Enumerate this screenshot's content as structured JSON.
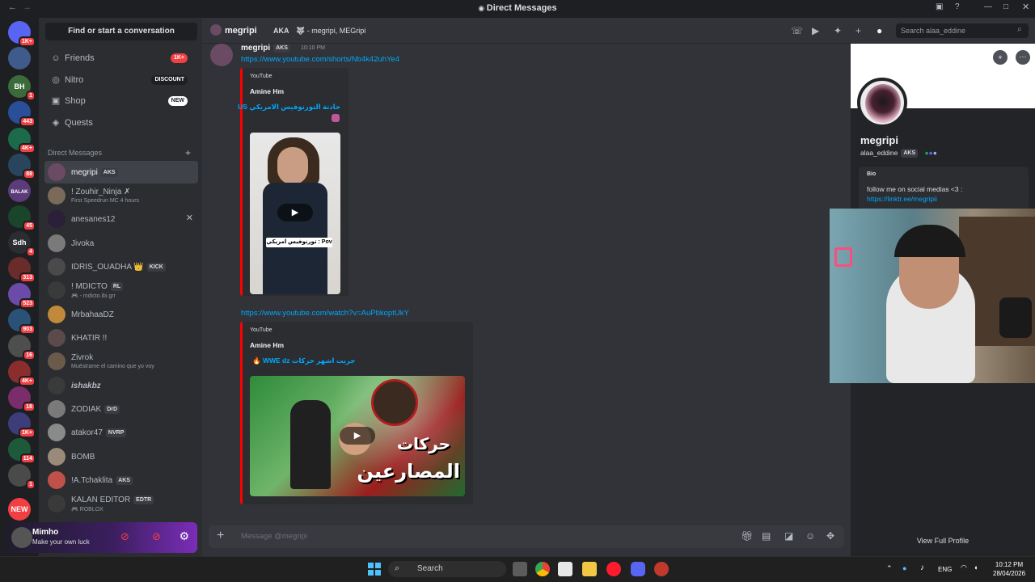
{
  "window": {
    "title": "Direct Messages"
  },
  "server_rail": {
    "items": [
      {
        "label": "",
        "badge": "1K+",
        "color": "#5865f2"
      },
      {
        "label": "",
        "badge": "",
        "color": "#3f5b8c"
      },
      {
        "label": "BH",
        "badge": "1",
        "color": "#3b6b3b"
      },
      {
        "label": "",
        "badge": "443",
        "color": "#2a4f9a"
      },
      {
        "label": "",
        "badge": "4K+",
        "color": "#1b6b4a"
      },
      {
        "label": "",
        "badge": "88",
        "color": "#29455e"
      },
      {
        "label": "BALAK",
        "badge": "",
        "color": "#5b3b7a"
      },
      {
        "label": "",
        "badge": "45",
        "color": "#19462a"
      },
      {
        "label": "Sdh",
        "badge": "4",
        "color": "#2b2d31"
      },
      {
        "label": "",
        "badge": "313",
        "color": "#6a2b2b"
      },
      {
        "label": "",
        "badge": "523",
        "color": "#6b4aa8"
      },
      {
        "label": "",
        "badge": "903",
        "color": "#2a5276"
      },
      {
        "label": "",
        "badge": "16",
        "color": "#4e4e4e"
      },
      {
        "label": "",
        "badge": "4K+",
        "color": "#8a2d2d"
      },
      {
        "label": "",
        "badge": "18",
        "color": "#7a2d6a"
      },
      {
        "label": "",
        "badge": "1K+",
        "color": "#3d3d7a"
      },
      {
        "label": "",
        "badge": "114",
        "color": "#1e5a3a"
      },
      {
        "label": "",
        "badge": "1",
        "color": "#4a4a4a"
      },
      {
        "label": "NEW",
        "badge": "",
        "color": "#f23f43"
      }
    ]
  },
  "sidebar": {
    "find_label": "Find or start a conversation",
    "nav": [
      {
        "label": "Friends",
        "icon": "friends-icon",
        "tag": "1K+",
        "tag_color": "#f23f43"
      },
      {
        "label": "Nitro",
        "icon": "nitro-icon",
        "tag": "DISCOUNT",
        "tag_color": "#1e1f22"
      },
      {
        "label": "Shop",
        "icon": "shop-icon",
        "tag": "NEW",
        "tag_color": "#ffffff"
      },
      {
        "label": "Quests",
        "icon": "quests-icon",
        "tag": "",
        "tag_color": ""
      }
    ],
    "dm_header": "Direct Messages",
    "dms": [
      {
        "name": "megripi",
        "tag": "AKS",
        "sub": "",
        "selected": true,
        "color": "#6b4a63"
      },
      {
        "name": "! Zouhir_Ninja ✗",
        "tag": "",
        "sub": "First Speedrun MC 4 hours",
        "selected": false,
        "color": "#7a6a5a"
      },
      {
        "name": "anesanes12",
        "tag": "",
        "sub": "",
        "selected": false,
        "color": "#2b1f3a"
      },
      {
        "name": "Jivoka",
        "tag": "",
        "sub": "",
        "selected": false,
        "color": "#7a7a7a"
      },
      {
        "name": "IDRIS_OUADHA 👑",
        "tag": "KICK",
        "sub": "",
        "selected": false,
        "color": "#4a4a4a"
      },
      {
        "name": "! MDICTO",
        "tag": "RL",
        "sub": "🎮 - mdicto.ibi.grr",
        "selected": false,
        "color": "#3a3a3a"
      },
      {
        "name": "MrbahaaDZ",
        "tag": "",
        "sub": "",
        "selected": false,
        "color": "#c08a3a"
      },
      {
        "name": "KHATIR !!",
        "tag": "",
        "sub": "",
        "selected": false,
        "color": "#5a4a4a"
      },
      {
        "name": "Zivrok",
        "tag": "",
        "sub": "Muéstrame el camino que yo voy",
        "selected": false,
        "color": "#6a5a4a"
      },
      {
        "name": "ishakbz",
        "tag": "",
        "sub": "",
        "selected": false,
        "color": "#3a3a3a"
      },
      {
        "name": "ZODIAK",
        "tag": "DrD",
        "sub": "",
        "selected": false,
        "color": "#7a7a7a"
      },
      {
        "name": "atakor47",
        "tag": "NVRP",
        "sub": "",
        "selected": false,
        "color": "#8a8a8a"
      },
      {
        "name": "BOMB",
        "tag": "",
        "sub": "",
        "selected": false,
        "color": "#9a8a7a"
      },
      {
        "name": "!A.Tchaklita",
        "tag": "AKS",
        "sub": "",
        "selected": false,
        "color": "#c0504a"
      },
      {
        "name": "KALAN EDITOR",
        "tag": "EDTR",
        "sub": "🎮 ROBLOX",
        "selected": false,
        "color": "#3a3a3a"
      }
    ]
  },
  "user_panel": {
    "name": "Mimho",
    "status": "Make your own luck"
  },
  "channel_header": {
    "name": "megripi",
    "aka_label": "AKA",
    "aka_names": "🐺 - megripi, MEGripi",
    "search_placeholder": "Search alaa_eddine"
  },
  "message": {
    "author": "megripi",
    "author_tag": "AKS",
    "time": "10:10 PM",
    "link1": "https://www.youtube.com/shorts/Nb4k42uhYe4",
    "embed1": {
      "provider": "YouTube",
      "author": "Amine Hm",
      "title": "حادثة التورنوفيس الامريكي US",
      "caption": "Pov : تورنوفيس امريكي"
    },
    "link2": "https://www.youtube.com/watch?v=AuPbkoptUkY",
    "embed2": {
      "provider": "YouTube",
      "author": "Amine Hm",
      "title": "🔥 WWE dz جريت اشهر حركات",
      "caption1": "حركات",
      "caption2": "المصارعين"
    }
  },
  "composer": {
    "placeholder": "Message @megripi"
  },
  "profile": {
    "display_name": "megripi",
    "username": "alaa_eddine",
    "tag": "AKS",
    "bio_label": "Bio",
    "bio_text": "follow me on social medias <3 :",
    "bio_link": "https://linktr.ee/megripii",
    "view_full": "View Full Profile"
  },
  "taskbar": {
    "search_label": "Search",
    "lang": "ENG",
    "time": "10:12 PM",
    "date": "28/04/2026"
  }
}
